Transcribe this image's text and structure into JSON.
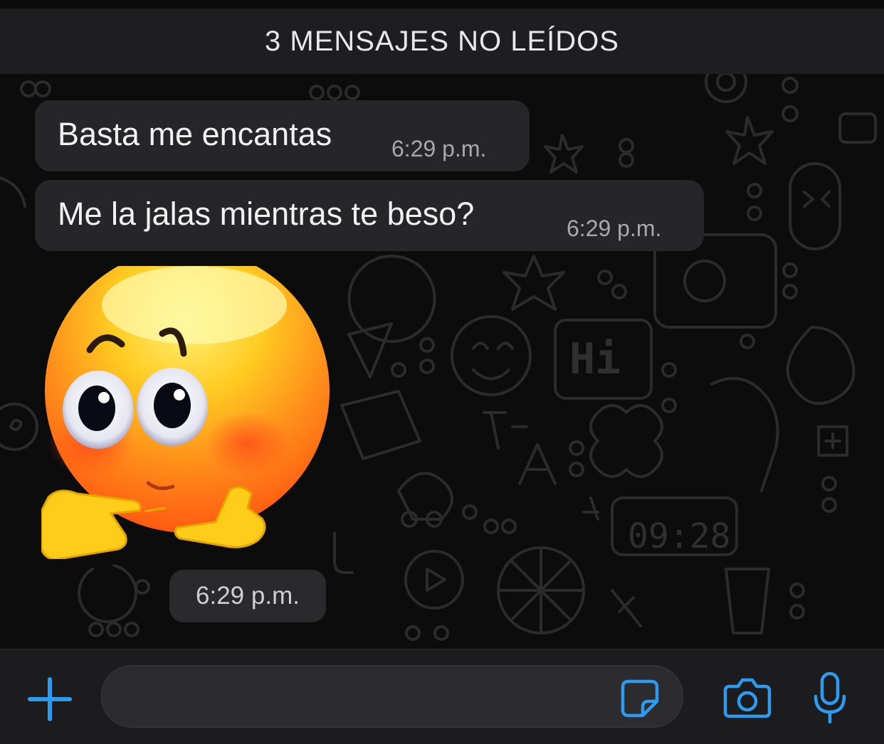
{
  "banner": {
    "unread_label": "3 MENSAJES NO LEÍDOS"
  },
  "messages": [
    {
      "text": "Basta me encantas",
      "time": "6:29 p.m."
    },
    {
      "text": "Me la jalas mientras te beso?",
      "time": "6:29 p.m."
    }
  ],
  "sticker": {
    "description_icon": "blushing-emoji-pointing-fingers",
    "time": "6:29 p.m."
  },
  "background_doodle": {
    "clock_text": "09:28",
    "hi_text": "Hi",
    "letter": "A"
  },
  "input_bar": {
    "value": "",
    "icons": {
      "add": "plus-icon",
      "sticker": "sticker-icon",
      "camera": "camera-icon",
      "mic": "microphone-icon"
    }
  },
  "colors": {
    "accent": "#2d9cf0",
    "bubble": "#262628",
    "banner": "#1e1e20",
    "background": "#0c0c0c"
  }
}
